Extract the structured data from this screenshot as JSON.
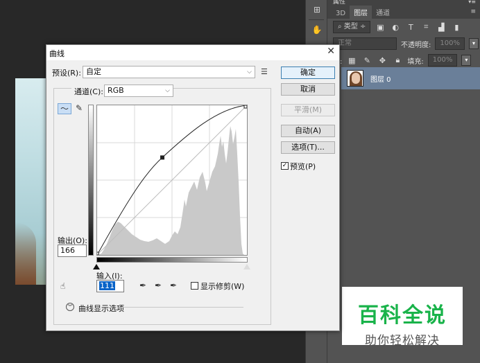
{
  "ps_panel": {
    "props_title": "属性",
    "tabs": [
      "3D",
      "图层",
      "通道"
    ],
    "filter_kind": "类型",
    "blend_mode": "正常",
    "opacity_label": "不透明度:",
    "opacity_value": "100%",
    "lock_label": "定:",
    "fill_label": "填充:",
    "fill_value": "100%",
    "layer_name": "图层 0"
  },
  "dialog": {
    "title": "曲线",
    "preset_label": "预设(R):",
    "preset_value": "自定",
    "channel_label": "通道(C):",
    "channel_value": "RGB",
    "output_label": "输出(O):",
    "output_value": "166",
    "input_label": "输入(I):",
    "input_value": "111",
    "show_clipping_label": "显示修剪(W)",
    "curve_options_label": "曲线显示选项",
    "buttons": {
      "ok": "确定",
      "cancel": "取消",
      "smooth": "平滑(M)",
      "auto": "自动(A)",
      "options": "选项(T)..."
    },
    "preview_label": "预览(P)",
    "preview_checked": true,
    "curve_point": {
      "input": 111,
      "output": 166
    }
  },
  "watermark": {
    "title": "百科全说",
    "subtitle": "助你轻松解决"
  }
}
